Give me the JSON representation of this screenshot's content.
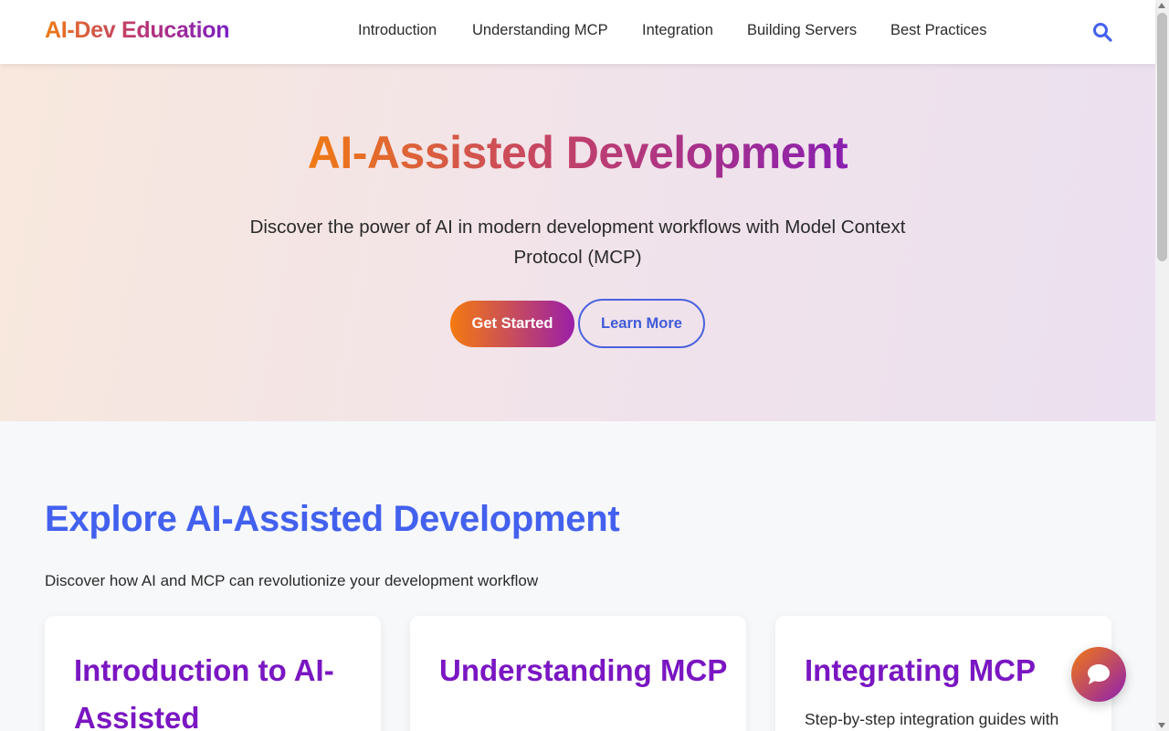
{
  "brand": {
    "logo_text": "AI-Dev Education"
  },
  "nav": {
    "items": [
      {
        "label": "Introduction"
      },
      {
        "label": "Understanding MCP"
      },
      {
        "label": "Integration"
      },
      {
        "label": "Building Servers"
      },
      {
        "label": "Best Practices"
      }
    ],
    "search_icon": "search-icon"
  },
  "hero": {
    "title": "AI-Assisted Development",
    "subtitle": "Discover the power of AI in modern development workflows with Model Context Protocol (MCP)",
    "primary_button": "Get Started",
    "secondary_button": "Learn More"
  },
  "explore": {
    "title": "Explore AI-Assisted Development",
    "subtitle": "Discover how AI and MCP can revolutionize your development workflow",
    "cards": [
      {
        "title": "Introduction to AI-Assisted",
        "description": ""
      },
      {
        "title": "Understanding MCP",
        "description": ""
      },
      {
        "title": "Integrating MCP",
        "description": "Step-by-step integration guides with"
      }
    ]
  },
  "chat": {
    "icon": "chat-bubble-icon"
  },
  "colors": {
    "accent_blue": "#4361ee",
    "brand_orange": "#f07a14",
    "brand_purple": "#7a16c2"
  }
}
